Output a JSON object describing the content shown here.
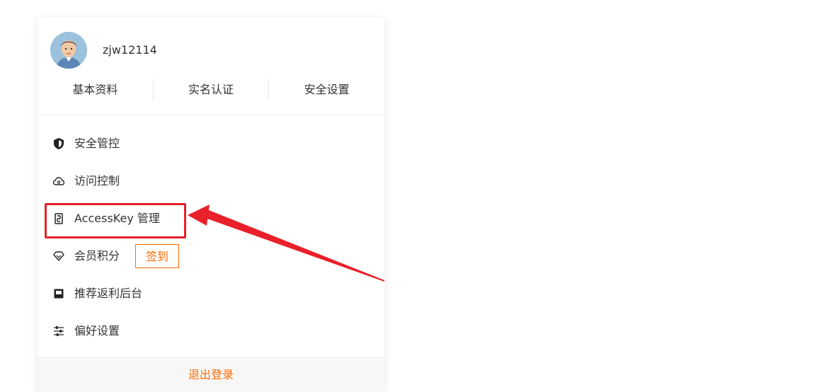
{
  "profile": {
    "username": "zjw12114",
    "links": [
      "基本资料",
      "实名认证",
      "安全设置"
    ]
  },
  "menu": {
    "items": [
      {
        "label": "安全管控",
        "icon": "shield-icon"
      },
      {
        "label": "访问控制",
        "icon": "cloud-icon"
      },
      {
        "label": "AccessKey 管理",
        "icon": "key-icon"
      },
      {
        "label": "会员积分",
        "icon": "diamond-icon",
        "action": "签到"
      },
      {
        "label": "推荐返利后台",
        "icon": "inbox-icon"
      },
      {
        "label": "偏好设置",
        "icon": "sliders-icon"
      }
    ]
  },
  "footer": {
    "logout_label": "退出登录"
  },
  "colors": {
    "accent": "#ff6a00",
    "annotation": "#e8202a"
  }
}
